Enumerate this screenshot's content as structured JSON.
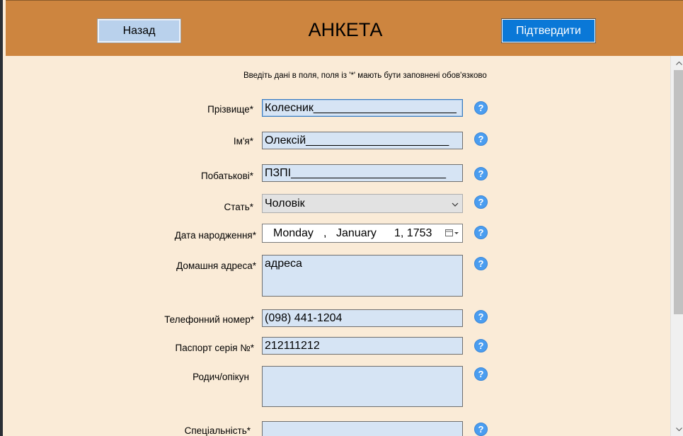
{
  "header": {
    "back_label": "Назад",
    "title": "АНКЕТА",
    "confirm_label": "Підтвердити"
  },
  "instructions": "Введіть дані в поля, поля із '*' мають бути заповнені обов'язково",
  "form": {
    "surname": {
      "label": "Прізвище*",
      "value": "Колесник",
      "underline": "________________________"
    },
    "first_name": {
      "label": "Ім'я*",
      "value": "Олексій",
      "underline": "________________________"
    },
    "patronymic": {
      "label": "Побатькові*",
      "value": "ПЗПІ",
      "underline": "__________________________"
    },
    "gender": {
      "label": "Стать*",
      "value": "Чоловік"
    },
    "birth_date": {
      "label": "Дата народження*",
      "weekday": "Monday",
      "comma": ",",
      "month": "January",
      "day_year": "1, 1753"
    },
    "address": {
      "label": "Домашня адреса*",
      "value": "адреса"
    },
    "phone": {
      "label": "Телефонний номер*",
      "value": "(098) 441-1204"
    },
    "passport": {
      "label": "Паспорт серія №*",
      "value": "212111212"
    },
    "guardian": {
      "label": "Родич/опікун",
      "value": ""
    },
    "specialty": {
      "label": "Спеціальність*",
      "value": ""
    }
  },
  "help_glyph": "?",
  "icons": {
    "dropdown": "chevron-down-icon",
    "calendar": "calendar-icon",
    "help": "help-icon"
  },
  "colors": {
    "header_bg": "#cd853f",
    "content_bg": "#faebd7",
    "field_bg": "#d6e4f4",
    "confirm_bg": "#0a78d7",
    "help_bg": "#4a9df0"
  }
}
